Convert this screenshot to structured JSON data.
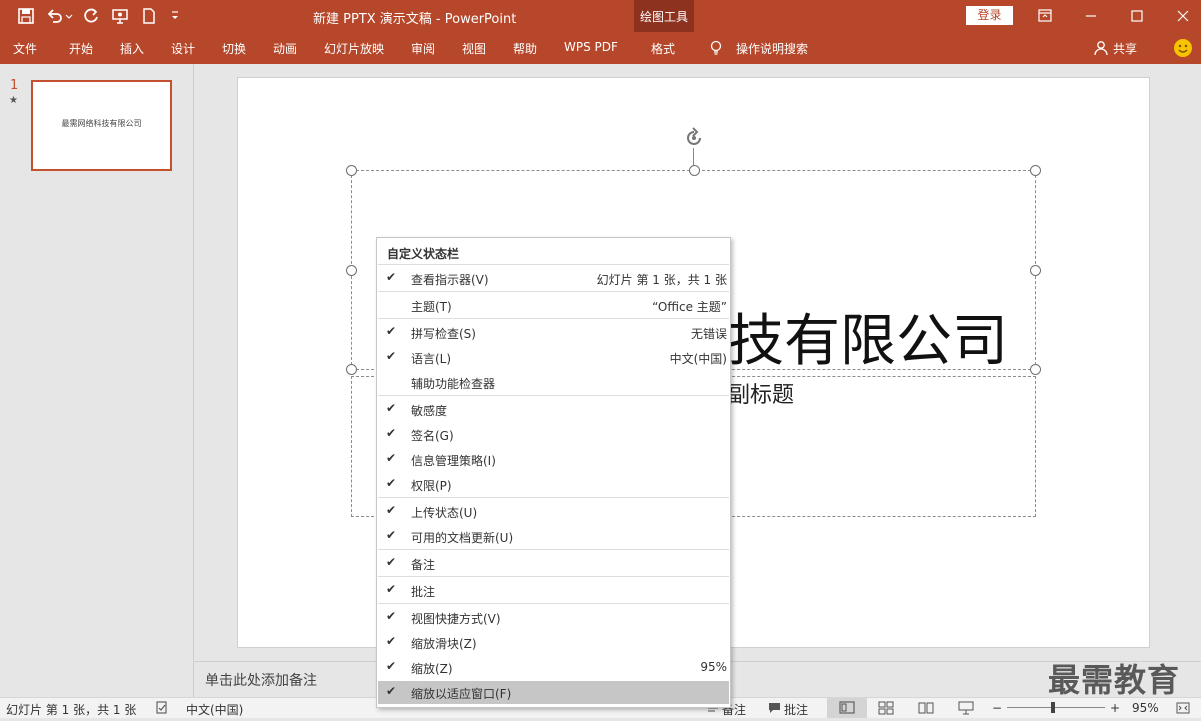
{
  "titlebar": {
    "title": "新建 PPTX 演示文稿  -  PowerPoint",
    "context_tab_group": "绘图工具",
    "login_label": "登录"
  },
  "ribbon": {
    "tabs": [
      "文件",
      "开始",
      "插入",
      "设计",
      "切换",
      "动画",
      "幻灯片放映",
      "审阅",
      "视图",
      "帮助",
      "WPS PDF",
      "格式"
    ],
    "tell_me": "操作说明搜索",
    "share": "共享"
  },
  "thumbnails": {
    "slide_number": "1",
    "slide_star": "★",
    "thumb_text": "最需网络科技有限公司"
  },
  "slide": {
    "title_visible": "技有限公司",
    "subtitle_visible": "副标题"
  },
  "notes": {
    "placeholder": "单击此处添加备注"
  },
  "context_menu": {
    "header": "自定义状态栏",
    "items": [
      {
        "checked": true,
        "label": "查看指示器(V)",
        "value": "幻灯片 第 1 张，共 1 张"
      },
      {
        "checked": false,
        "label": "主题(T)",
        "value": "“Office 主题”"
      },
      {
        "checked": true,
        "label": "拼写检查(S)",
        "value": "无错误"
      },
      {
        "checked": true,
        "label": "语言(L)",
        "value": "中文(中国)"
      },
      {
        "checked": false,
        "label": "辅助功能检查器",
        "value": ""
      },
      {
        "checked": true,
        "label": "敏感度",
        "value": ""
      },
      {
        "checked": true,
        "label": "签名(G)",
        "value": ""
      },
      {
        "checked": true,
        "label": "信息管理策略(I)",
        "value": ""
      },
      {
        "checked": true,
        "label": "权限(P)",
        "value": ""
      },
      {
        "checked": true,
        "label": "上传状态(U)",
        "value": ""
      },
      {
        "checked": true,
        "label": "可用的文档更新(U)",
        "value": ""
      },
      {
        "checked": true,
        "label": "备注",
        "value": ""
      },
      {
        "checked": true,
        "label": "批注",
        "value": ""
      },
      {
        "checked": true,
        "label": "视图快捷方式(V)",
        "value": ""
      },
      {
        "checked": true,
        "label": "缩放滑块(Z)",
        "value": ""
      },
      {
        "checked": true,
        "label": "缩放(Z)",
        "value": "95%"
      },
      {
        "checked": true,
        "label": "缩放以适应窗口(F)",
        "value": ""
      }
    ]
  },
  "statusbar": {
    "slide_info": "幻灯片 第 1 张，共 1 张",
    "language": "中文(中国)",
    "notes": "备注",
    "comments": "批注",
    "zoom_minus": "−",
    "zoom_plus": "+",
    "zoom": "95%",
    "zoom_level_percent": 95
  },
  "watermark": "最需教育",
  "colors": {
    "accent": "#b7472a",
    "context_tab": "#8e3220",
    "highlight": "#c6c6c6"
  }
}
